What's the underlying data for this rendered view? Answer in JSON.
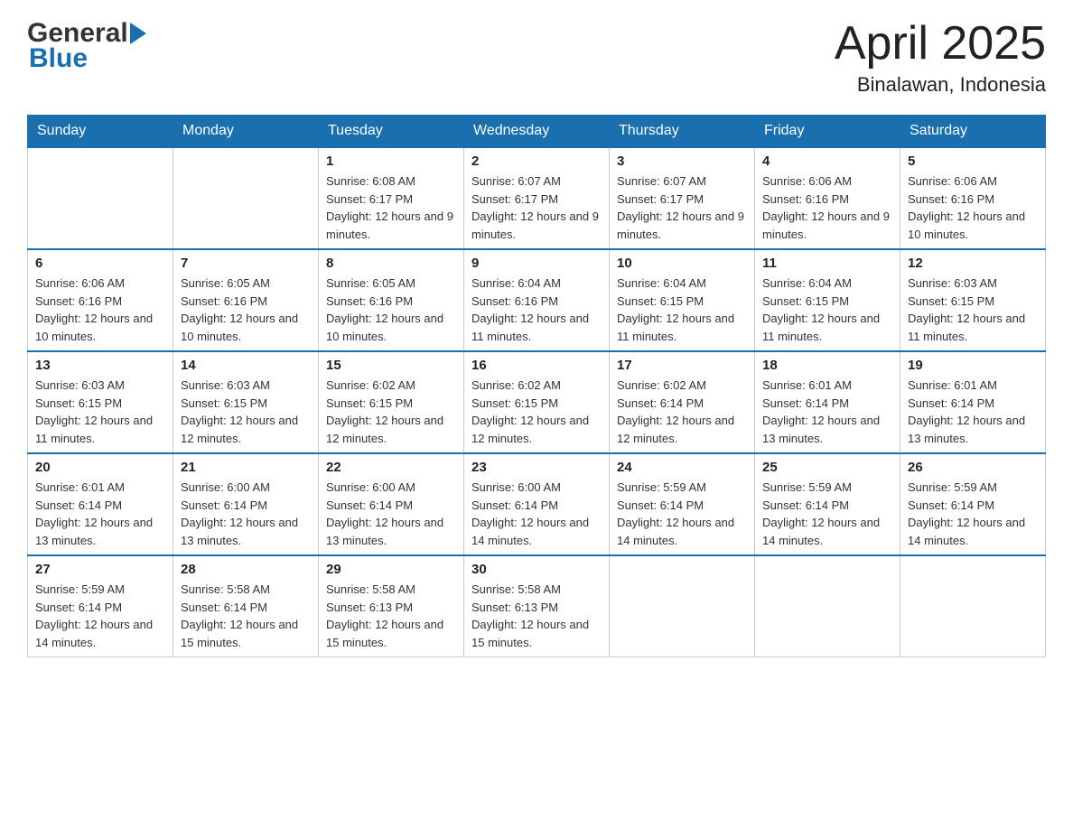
{
  "header": {
    "logo_general": "General",
    "logo_blue": "Blue",
    "title": "April 2025",
    "subtitle": "Binalawan, Indonesia"
  },
  "calendar": {
    "days_of_week": [
      "Sunday",
      "Monday",
      "Tuesday",
      "Wednesday",
      "Thursday",
      "Friday",
      "Saturday"
    ],
    "weeks": [
      [
        {
          "day": "",
          "info": ""
        },
        {
          "day": "",
          "info": ""
        },
        {
          "day": "1",
          "info": "Sunrise: 6:08 AM\nSunset: 6:17 PM\nDaylight: 12 hours\nand 9 minutes."
        },
        {
          "day": "2",
          "info": "Sunrise: 6:07 AM\nSunset: 6:17 PM\nDaylight: 12 hours\nand 9 minutes."
        },
        {
          "day": "3",
          "info": "Sunrise: 6:07 AM\nSunset: 6:17 PM\nDaylight: 12 hours\nand 9 minutes."
        },
        {
          "day": "4",
          "info": "Sunrise: 6:06 AM\nSunset: 6:16 PM\nDaylight: 12 hours\nand 9 minutes."
        },
        {
          "day": "5",
          "info": "Sunrise: 6:06 AM\nSunset: 6:16 PM\nDaylight: 12 hours\nand 10 minutes."
        }
      ],
      [
        {
          "day": "6",
          "info": "Sunrise: 6:06 AM\nSunset: 6:16 PM\nDaylight: 12 hours\nand 10 minutes."
        },
        {
          "day": "7",
          "info": "Sunrise: 6:05 AM\nSunset: 6:16 PM\nDaylight: 12 hours\nand 10 minutes."
        },
        {
          "day": "8",
          "info": "Sunrise: 6:05 AM\nSunset: 6:16 PM\nDaylight: 12 hours\nand 10 minutes."
        },
        {
          "day": "9",
          "info": "Sunrise: 6:04 AM\nSunset: 6:16 PM\nDaylight: 12 hours\nand 11 minutes."
        },
        {
          "day": "10",
          "info": "Sunrise: 6:04 AM\nSunset: 6:15 PM\nDaylight: 12 hours\nand 11 minutes."
        },
        {
          "day": "11",
          "info": "Sunrise: 6:04 AM\nSunset: 6:15 PM\nDaylight: 12 hours\nand 11 minutes."
        },
        {
          "day": "12",
          "info": "Sunrise: 6:03 AM\nSunset: 6:15 PM\nDaylight: 12 hours\nand 11 minutes."
        }
      ],
      [
        {
          "day": "13",
          "info": "Sunrise: 6:03 AM\nSunset: 6:15 PM\nDaylight: 12 hours\nand 11 minutes."
        },
        {
          "day": "14",
          "info": "Sunrise: 6:03 AM\nSunset: 6:15 PM\nDaylight: 12 hours\nand 12 minutes."
        },
        {
          "day": "15",
          "info": "Sunrise: 6:02 AM\nSunset: 6:15 PM\nDaylight: 12 hours\nand 12 minutes."
        },
        {
          "day": "16",
          "info": "Sunrise: 6:02 AM\nSunset: 6:15 PM\nDaylight: 12 hours\nand 12 minutes."
        },
        {
          "day": "17",
          "info": "Sunrise: 6:02 AM\nSunset: 6:14 PM\nDaylight: 12 hours\nand 12 minutes."
        },
        {
          "day": "18",
          "info": "Sunrise: 6:01 AM\nSunset: 6:14 PM\nDaylight: 12 hours\nand 13 minutes."
        },
        {
          "day": "19",
          "info": "Sunrise: 6:01 AM\nSunset: 6:14 PM\nDaylight: 12 hours\nand 13 minutes."
        }
      ],
      [
        {
          "day": "20",
          "info": "Sunrise: 6:01 AM\nSunset: 6:14 PM\nDaylight: 12 hours\nand 13 minutes."
        },
        {
          "day": "21",
          "info": "Sunrise: 6:00 AM\nSunset: 6:14 PM\nDaylight: 12 hours\nand 13 minutes."
        },
        {
          "day": "22",
          "info": "Sunrise: 6:00 AM\nSunset: 6:14 PM\nDaylight: 12 hours\nand 13 minutes."
        },
        {
          "day": "23",
          "info": "Sunrise: 6:00 AM\nSunset: 6:14 PM\nDaylight: 12 hours\nand 14 minutes."
        },
        {
          "day": "24",
          "info": "Sunrise: 5:59 AM\nSunset: 6:14 PM\nDaylight: 12 hours\nand 14 minutes."
        },
        {
          "day": "25",
          "info": "Sunrise: 5:59 AM\nSunset: 6:14 PM\nDaylight: 12 hours\nand 14 minutes."
        },
        {
          "day": "26",
          "info": "Sunrise: 5:59 AM\nSunset: 6:14 PM\nDaylight: 12 hours\nand 14 minutes."
        }
      ],
      [
        {
          "day": "27",
          "info": "Sunrise: 5:59 AM\nSunset: 6:14 PM\nDaylight: 12 hours\nand 14 minutes."
        },
        {
          "day": "28",
          "info": "Sunrise: 5:58 AM\nSunset: 6:14 PM\nDaylight: 12 hours\nand 15 minutes."
        },
        {
          "day": "29",
          "info": "Sunrise: 5:58 AM\nSunset: 6:13 PM\nDaylight: 12 hours\nand 15 minutes."
        },
        {
          "day": "30",
          "info": "Sunrise: 5:58 AM\nSunset: 6:13 PM\nDaylight: 12 hours\nand 15 minutes."
        },
        {
          "day": "",
          "info": ""
        },
        {
          "day": "",
          "info": ""
        },
        {
          "day": "",
          "info": ""
        }
      ]
    ]
  }
}
